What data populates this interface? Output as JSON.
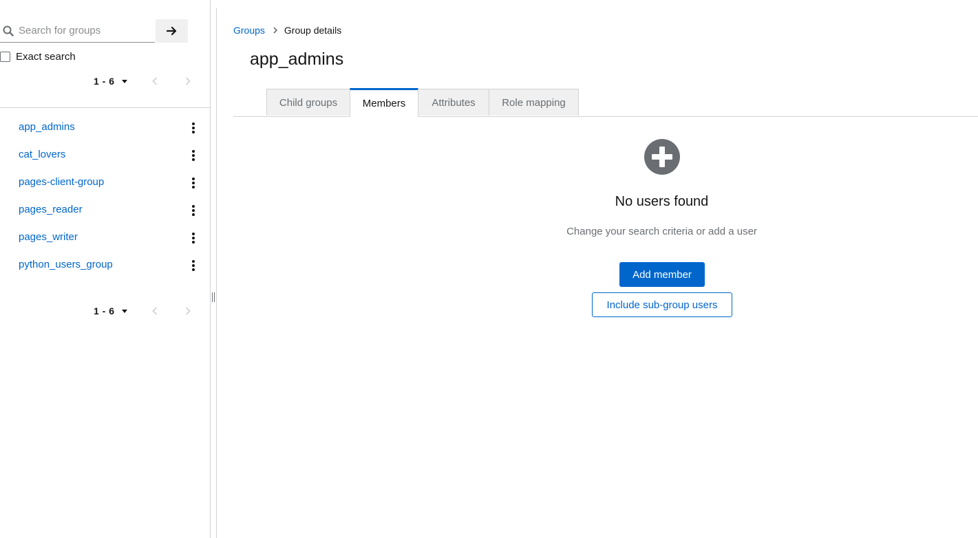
{
  "sidebar": {
    "search": {
      "placeholder": "Search for groups",
      "value": ""
    },
    "exact_search_label": "Exact search",
    "exact_search_checked": false,
    "pager_top": {
      "range": "1 - 6"
    },
    "pager_bottom": {
      "range": "1 - 6"
    },
    "groups": [
      {
        "label": "app_admins"
      },
      {
        "label": "cat_lovers"
      },
      {
        "label": "pages-client-group"
      },
      {
        "label": "pages_reader"
      },
      {
        "label": "pages_writer"
      },
      {
        "label": "python_users_group"
      }
    ]
  },
  "breadcrumb": {
    "root": "Groups",
    "current": "Group details"
  },
  "page_title": "app_admins",
  "tabs": [
    {
      "label": "Child groups",
      "active": false
    },
    {
      "label": "Members",
      "active": true
    },
    {
      "label": "Attributes",
      "active": false
    },
    {
      "label": "Role mapping",
      "active": false
    }
  ],
  "empty_state": {
    "icon": "plus-circle-icon",
    "title": "No users found",
    "body": "Change your search criteria or add a user",
    "primary_action": "Add member",
    "secondary_action": "Include sub-group users"
  },
  "colors": {
    "link": "#0066cc",
    "primary": "#0066cc",
    "muted_text": "#6a6e73",
    "tab_inactive_bg": "#f0f0f0",
    "empty_icon": "#6a6e73"
  }
}
